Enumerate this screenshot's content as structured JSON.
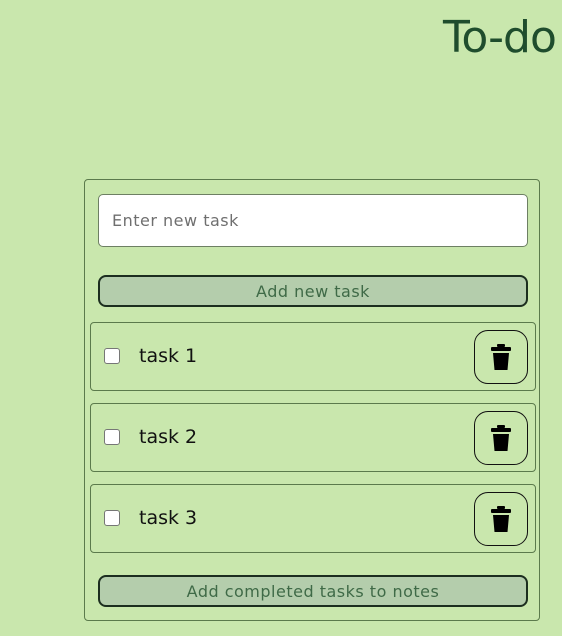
{
  "header": {
    "title": "To-do"
  },
  "new_task": {
    "placeholder": "Enter new task",
    "value": ""
  },
  "buttons": {
    "add_task_label": "Add new task",
    "add_to_notes_label": "Add completed tasks to notes"
  },
  "tasks": [
    {
      "label": "task 1",
      "completed": false,
      "delete_icon": "trash-icon"
    },
    {
      "label": "task 2",
      "completed": false,
      "delete_icon": "trash-icon"
    },
    {
      "label": "task 3",
      "completed": false,
      "delete_icon": "trash-icon"
    }
  ],
  "colors": {
    "background": "#c9e7ad",
    "title": "#1f4d2d",
    "button_fill": "#b4cdac",
    "button_text": "#3f6a47",
    "button_border": "#1c2e1f"
  }
}
